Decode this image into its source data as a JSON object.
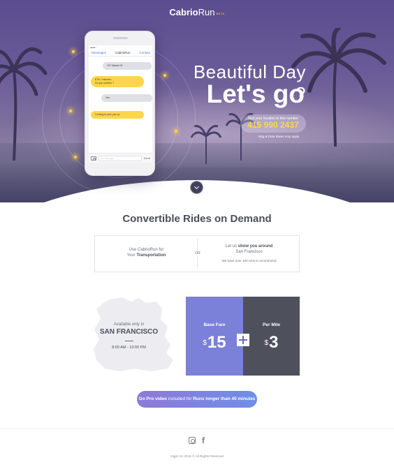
{
  "brand": {
    "name_bold": "Cabrio",
    "name_light": "Run",
    "tag": "BETA"
  },
  "phone": {
    "nav_back": "Messages",
    "nav_title": "CabrioRun",
    "nav_contact": "Contact",
    "messages": [
      {
        "side": "gray",
        "text": "757 Market St"
      },
      {
        "side": "yellow",
        "line1": "ETA 7 minutes...",
        "line2": "Do you confirm ?"
      },
      {
        "side": "gray",
        "text": "Yes"
      },
      {
        "side": "yellow",
        "text": "Coming to pick you up"
      }
    ],
    "input_placeholder": "Text Message",
    "send_label": "Send"
  },
  "hero": {
    "headline_small": "Beautiful Day ?",
    "headline_big": "Let's go",
    "sms_label": "Text your location to this number",
    "sms_number": "415 990 2437",
    "sms_note": "Msg & Data Rates may apply"
  },
  "section": {
    "title": "Convertible Rides on Demand",
    "left_pre": "Use CabrioRun for",
    "left_line2_pre": "Your ",
    "left_line2_bold": "Transportation",
    "or": "OR",
    "right_pre": "Let us ",
    "right_bold": "show you around",
    "right_line2": "San Francisco",
    "right_sub": "We have over 100 runs to recommend"
  },
  "availability": {
    "label": "Available only in",
    "city": "SAN FRANCISCO",
    "hours": "8:00 AM - 10:00 PM"
  },
  "fares": {
    "base_label": "Base Fare",
    "base_currency": "$",
    "base_value": "15",
    "mile_label": "Per Mile",
    "mile_currency": "$",
    "mile_value": "3"
  },
  "cta": {
    "bold1": "Go Pro video",
    "middle": " included for ",
    "bold2": "Runs longer than 40 minutes"
  },
  "footer": {
    "copyright": "Oggz Inc 2015 © All Rights Reserved"
  },
  "colors": {
    "accent": "#ffd54a",
    "fare_base": "#7b80d8",
    "fare_mile": "#4e505c",
    "hero": "#5a4d8f"
  }
}
